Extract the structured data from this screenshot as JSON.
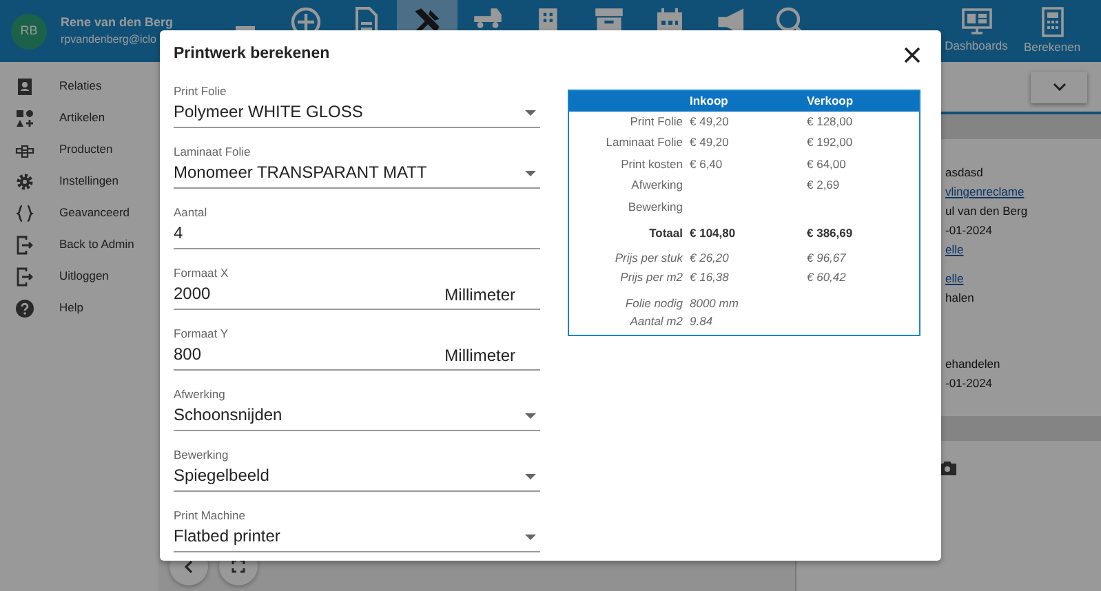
{
  "user": {
    "initials": "RB",
    "name": "Rene van den Berg",
    "email": "rpvandenberg@iclo"
  },
  "toolbar": [
    {
      "kind": "minus",
      "selected": false
    },
    {
      "kind": "plus",
      "selected": false
    },
    {
      "kind": "doc",
      "selected": false
    },
    {
      "kind": "tools",
      "selected": true
    },
    {
      "kind": "truck",
      "selected": false
    },
    {
      "kind": "building",
      "selected": false
    },
    {
      "kind": "archive",
      "selected": false
    },
    {
      "kind": "calendar",
      "selected": false
    },
    {
      "kind": "megaphone",
      "selected": false
    },
    {
      "kind": "search",
      "selected": false
    }
  ],
  "toolbar_labeled": [
    {
      "kind": "dashboard",
      "label": "Dashboards"
    },
    {
      "kind": "calculator",
      "label": "Berekenen"
    }
  ],
  "sidebar": {
    "items": [
      {
        "kind": "contacts",
        "label": "Relaties"
      },
      {
        "kind": "shapes",
        "label": "Artikelen"
      },
      {
        "kind": "products",
        "label": "Producten"
      },
      {
        "kind": "gear",
        "label": "Instellingen"
      },
      {
        "kind": "braces",
        "label": "Geavanceerd"
      },
      {
        "kind": "exit",
        "label": "Back to Admin"
      },
      {
        "kind": "exit",
        "label": "Uitloggen"
      },
      {
        "kind": "help",
        "label": "Help"
      }
    ]
  },
  "detail_groups": [
    [
      {
        "kind": "text",
        "text": "asdasd"
      },
      {
        "kind": "link",
        "text": "vlingenreclame"
      },
      {
        "kind": "text",
        "text": "ul van den Berg"
      },
      {
        "kind": "text",
        "text": "-01-2024"
      },
      {
        "kind": "link",
        "text": "elle"
      }
    ],
    [
      {
        "kind": "link",
        "text": "elle"
      },
      {
        "kind": "text",
        "text": "halen"
      }
    ],
    [
      {
        "kind": "text",
        "text": "ehandelen"
      },
      {
        "kind": "text",
        "text": "-01-2024"
      }
    ]
  ],
  "modal": {
    "title": "Printwerk berekenen",
    "fields": [
      {
        "kind": "select",
        "label": "Print Folie",
        "value": "Polymeer WHITE GLOSS"
      },
      {
        "kind": "select",
        "label": "Laminaat Folie",
        "value": "Monomeer TRANSPARANT MATT"
      },
      {
        "kind": "input",
        "label": "Aantal",
        "value": "4"
      },
      {
        "kind": "input",
        "label": "Formaat X",
        "value": "2000",
        "unit": "Millimeter"
      },
      {
        "kind": "input",
        "label": "Formaat Y",
        "value": "800",
        "unit": "Millimeter"
      },
      {
        "kind": "select",
        "label": "Afwerking",
        "value": "Schoonsnijden"
      },
      {
        "kind": "select",
        "label": "Bewerking",
        "value": "Spiegelbeeld"
      },
      {
        "kind": "select",
        "label": "Print Machine",
        "value": "Flatbed printer"
      }
    ],
    "table": {
      "columns": [
        "Inkoop",
        "Verkoop"
      ],
      "rows": [
        {
          "kind": "cost",
          "label": "Print Folie",
          "inkoop": "€ 49,20",
          "verkoop": "€ 128,00"
        },
        {
          "kind": "cost",
          "label": "Laminaat Folie",
          "inkoop": "€ 49,20",
          "verkoop": "€ 192,00"
        },
        {
          "kind": "cost",
          "label": "Print kosten",
          "inkoop": "€ 6,40",
          "verkoop": "€ 64,00"
        },
        {
          "kind": "cost",
          "label": "Afwerking",
          "verkoop": "€ 2,69"
        },
        {
          "kind": "cost",
          "label": "Bewerking"
        },
        {
          "kind": "total",
          "label": "Totaal",
          "inkoop": "€ 104,80",
          "verkoop": "€ 386,69"
        },
        {
          "kind": "per",
          "label": "Prijs per stuk",
          "inkoop": "€ 26,20",
          "verkoop": "€ 96,67"
        },
        {
          "kind": "per",
          "label": "Prijs per m2",
          "inkoop": "€ 16,38",
          "verkoop": "€ 60,42"
        },
        {
          "kind": "usage",
          "label": "Folie nodig",
          "inkoop": "8000 mm"
        },
        {
          "kind": "usage",
          "label": "Aantal m2",
          "inkoop": "9.84"
        }
      ]
    }
  }
}
